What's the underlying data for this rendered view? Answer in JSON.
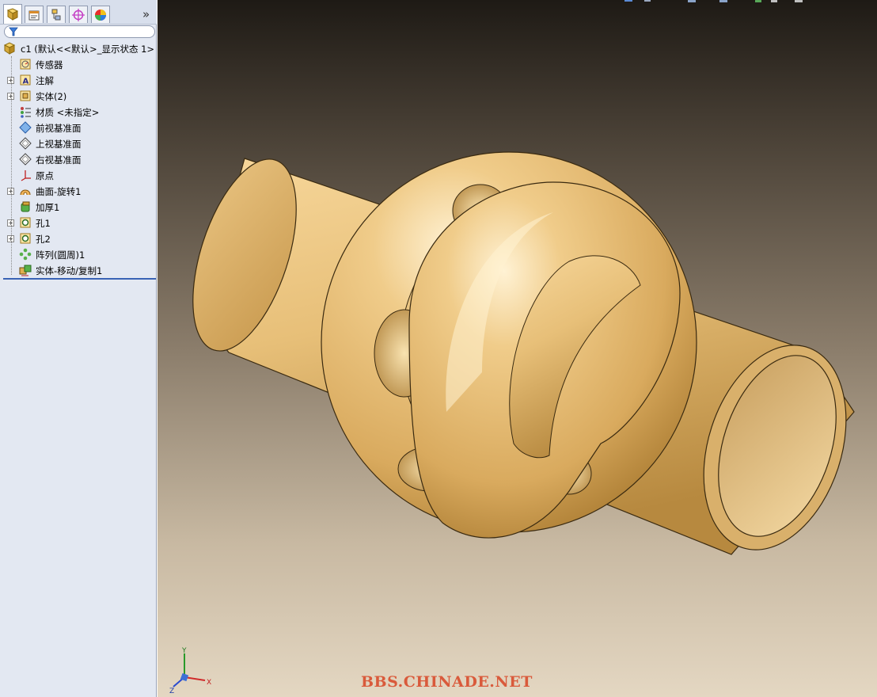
{
  "feature_tree": {
    "filter_placeholder": "",
    "root_label": "c1  (默认<<默认>_显示状态 1>",
    "items": [
      {
        "label": "传感器",
        "icon": "sensor-icon",
        "expandable": false
      },
      {
        "label": "注解",
        "icon": "annotation-icon",
        "expandable": true
      },
      {
        "label": "实体(2)",
        "icon": "solid-bodies-icon",
        "expandable": true
      },
      {
        "label": "材质 <未指定>",
        "icon": "material-icon",
        "expandable": false
      },
      {
        "label": "前视基准面",
        "icon": "plane-icon",
        "expandable": false
      },
      {
        "label": "上视基准面",
        "icon": "plane-icon",
        "expandable": false
      },
      {
        "label": "右视基准面",
        "icon": "plane-icon",
        "expandable": false
      },
      {
        "label": "原点",
        "icon": "origin-icon",
        "expandable": false
      },
      {
        "label": "曲面-旋转1",
        "icon": "revolve-surface-icon",
        "expandable": true
      },
      {
        "label": "加厚1",
        "icon": "thicken-icon",
        "expandable": false
      },
      {
        "label": "孔1",
        "icon": "hole-icon",
        "expandable": true
      },
      {
        "label": "孔2",
        "icon": "hole-icon",
        "expandable": true
      },
      {
        "label": "阵列(圆周)1",
        "icon": "circular-pattern-icon",
        "expandable": false
      },
      {
        "label": "实体-移动/复制1",
        "icon": "move-copy-body-icon",
        "expandable": false
      }
    ]
  },
  "tabs": [
    {
      "name": "feature-manager-tab",
      "icon": "feature-manager-icon"
    },
    {
      "name": "property-manager-tab",
      "icon": "property-manager-icon"
    },
    {
      "name": "configuration-manager-tab",
      "icon": "configuration-manager-icon"
    },
    {
      "name": "dimxpert-manager-tab",
      "icon": "dimxpert-icon"
    },
    {
      "name": "display-manager-tab",
      "icon": "display-manager-icon"
    }
  ],
  "tabs_more_label": "»",
  "viewport": {
    "watermark": "BBS.CHINADE.NET",
    "triad": {
      "x": "X",
      "y": "Y",
      "z": "Z"
    },
    "model_color": "#e9c07a",
    "background_top": "#1e1a15",
    "background_bottom": "#e4d7c2"
  }
}
